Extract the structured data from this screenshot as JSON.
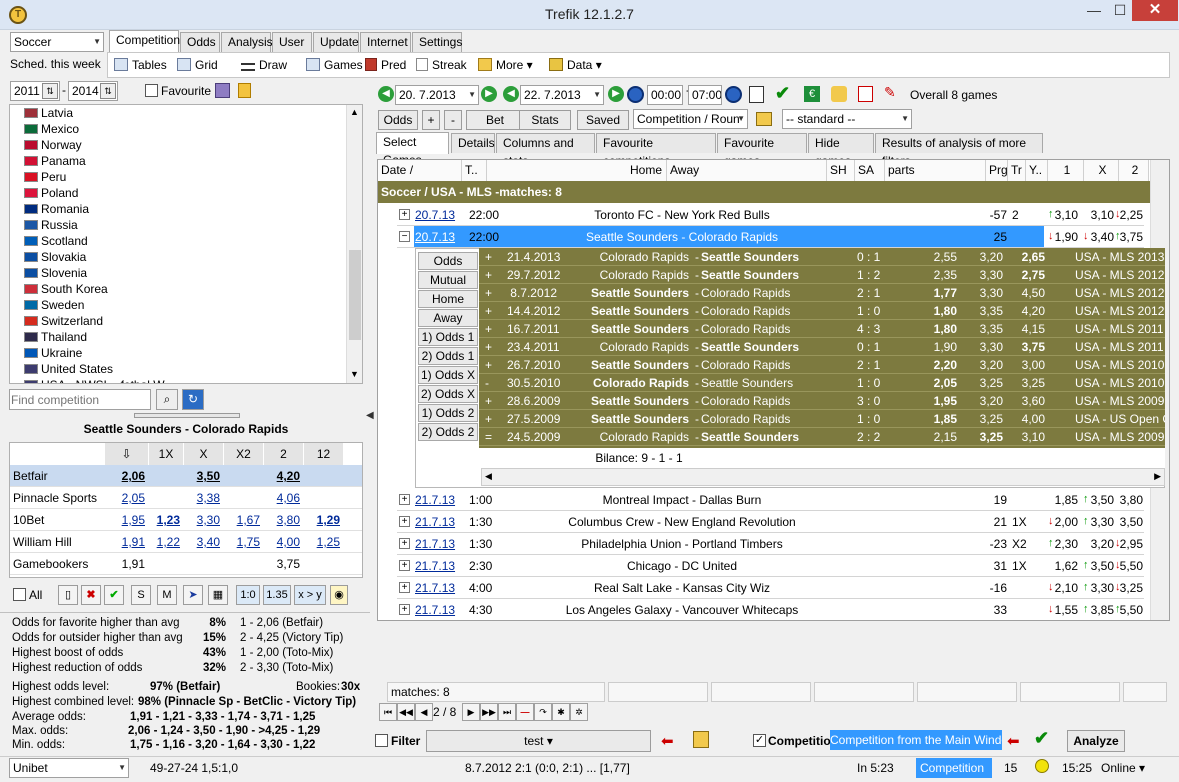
{
  "app": {
    "title": "Trefik 12.1.2.7"
  },
  "left": {
    "sport": "Soccer",
    "sched": "Sched. this week",
    "year_from": "2011",
    "year_to": "2014",
    "favourite_label": "Favourite",
    "countries": [
      "Latvia",
      "Mexico",
      "Norway",
      "Panama",
      "Peru",
      "Poland",
      "Romania",
      "Russia",
      "Scotland",
      "Slovakia",
      "Slovenia",
      "South Korea",
      "Sweden",
      "Switzerland",
      "Thailand",
      "Ukraine",
      "United States",
      "USA - NWSL - fotbal W"
    ],
    "find_placeholder": "Find competition",
    "match_title": "Seattle Sounders - Colorado Rapids",
    "odds_headers": [
      "1X",
      "X",
      "X2",
      "2",
      "12"
    ],
    "bookies": [
      {
        "name": "Betfair",
        "v": [
          "2,06",
          "",
          "3,50",
          "",
          "4,20",
          ""
        ]
      },
      {
        "name": "Pinnacle Sports",
        "v": [
          "2,05",
          "",
          "3,38",
          "",
          "4,06",
          ""
        ]
      },
      {
        "name": "10Bet",
        "v": [
          "1,95",
          "1,23",
          "3,30",
          "1,67",
          "3,80",
          "1,29"
        ]
      },
      {
        "name": "William Hill",
        "v": [
          "1,91",
          "1,22",
          "3,40",
          "1,75",
          "4,00",
          "1,25"
        ]
      },
      {
        "name": "Gamebookers",
        "v": [
          "1,91",
          "",
          "",
          "",
          "3,75",
          ""
        ]
      }
    ],
    "all_label": "All",
    "btn_s": "S",
    "btn_m": "M",
    "btn_10": "1:0",
    "btn_135": "1.35",
    "btn_xy": "x > y",
    "stats": [
      {
        "label": "Odds for favorite higher than avg",
        "value": "8%",
        "detail": "1 - 2,06 (Betfair)"
      },
      {
        "label": "Odds for outsider higher than avg",
        "value": "15%",
        "detail": "2 - 4,25 (Victory Tip)"
      },
      {
        "label": "Highest boost of odds",
        "value": "43%",
        "detail": "1 - 2,00 (Toto-Mix)"
      },
      {
        "label": "Highest reduction of odds",
        "value": "32%",
        "detail": "2 - 3,30 (Toto-Mix)"
      }
    ],
    "highest_level_label": "Highest odds level:",
    "highest_level_value": "97% (Betfair)",
    "bookies_label": "Bookies:",
    "bookies_value": "30x",
    "combined_label": "Highest combined level:",
    "combined_value": "98% (Pinnacle Sp - BetClic - Victory Tip)",
    "avg_label": "Average odds:",
    "avg_value": "1,91 - 1,21 - 3,33 - 1,74 - 3,71 - 1,25",
    "max_label": "Max. odds:",
    "max_value": "2,06 - 1,24 - 3,50 - 1,90 - >4,25 - 1,29",
    "min_label": "Min. odds:",
    "min_value": "1,75 - 1,16 - 3,20 - 1,64 - 3,30 - 1,22"
  },
  "tabs": [
    "Competition",
    "Odds",
    "Analysis",
    "User",
    "Update",
    "Internet",
    "Settings"
  ],
  "tools": [
    "Tables",
    "Grid",
    "Draw",
    "Games",
    "Pred",
    "Streak",
    "More",
    "Data"
  ],
  "filters": {
    "date_from": "20.  7.2013",
    "date_to": "22.  7.2013",
    "time_from": "00:00",
    "time_to": "07:00",
    "overall": "Overall 8 games",
    "b_odds": "Odds",
    "b_plus": "+",
    "b_minus": "-",
    "b_bet": "Bet",
    "b_stats": "Stats",
    "b_saved": "Saved",
    "round": "Competition / Roun",
    "standard": "-- standard --"
  },
  "subtabs": [
    "Select Games",
    "Details",
    "Columns and stats",
    "Favourite competitions",
    "Favourite games",
    "Hide games",
    "Results of analysis of more filters"
  ],
  "grid": {
    "headers": [
      "Date",
      "T..",
      "Home",
      "Away",
      "SH",
      "SA",
      "parts",
      "Prg",
      "Tr",
      "Y..",
      "1",
      "X",
      "2"
    ],
    "group": "Soccer / USA - MLS -matches: 8",
    "rows": [
      {
        "d": "20.7.13",
        "t": "22:00",
        "m": "Toronto FC - New York Red Bulls",
        "p": "-57",
        "tr": "2",
        "o1": "3,10",
        "ox": "3,10",
        "o2": "2,25"
      },
      {
        "d": "20.7.13",
        "t": "22:00",
        "m": "Seattle Sounders - Colorado Rapids",
        "p": "25",
        "tr": "",
        "o1": "1,90",
        "ox": "3,40",
        "o2": "3,75"
      },
      {
        "d": "21.7.13",
        "t": "1:00",
        "m": "Montreal Impact - Dallas Burn",
        "p": "19",
        "tr": "",
        "o1": "1,85",
        "ox": "3,50",
        "o2": "3,80"
      },
      {
        "d": "21.7.13",
        "t": "1:30",
        "m": "Columbus Crew - New England Revolution",
        "p": "21",
        "tr": "1X",
        "o1": "2,00",
        "ox": "3,30",
        "o2": "3,50"
      },
      {
        "d": "21.7.13",
        "t": "1:30",
        "m": "Philadelphia Union - Portland Timbers",
        "p": "-23",
        "tr": "X2",
        "o1": "2,30",
        "ox": "3,20",
        "o2": "2,95"
      },
      {
        "d": "21.7.13",
        "t": "2:30",
        "m": "Chicago - DC United",
        "p": "31",
        "tr": "1X",
        "o1": "1,62",
        "ox": "3,50",
        "o2": "5,50"
      },
      {
        "d": "21.7.13",
        "t": "4:00",
        "m": "Real Salt Lake - Kansas City Wiz",
        "p": "-16",
        "tr": "",
        "o1": "2,10",
        "ox": "3,30",
        "o2": "3,25"
      },
      {
        "d": "21.7.13",
        "t": "4:30",
        "m": "Los Angeles Galaxy - Vancouver Whitecaps",
        "p": "33",
        "tr": "",
        "o1": "1,55",
        "ox": "3,85",
        "o2": "5,50"
      }
    ]
  },
  "history": {
    "side": [
      "Odds",
      "Mutual",
      "Home",
      "Away",
      "1) Odds 1",
      "2) Odds 1",
      "1) Odds X",
      "2) Odds X",
      "1) Odds 2",
      "2) Odds 2"
    ],
    "rows": [
      {
        "s": "+",
        "d": "21.4.2013",
        "h": "Colorado Rapids",
        "a": "Seattle Sounders",
        "sc": "0 : 1",
        "o1": "2,55",
        "ox": "3,20",
        "o2": "2,65",
        "c": "USA - MLS 2013"
      },
      {
        "s": "+",
        "d": "29.7.2012",
        "h": "Colorado Rapids",
        "a": "Seattle Sounders",
        "sc": "1 : 2",
        "o1": "2,35",
        "ox": "3,30",
        "o2": "2,75",
        "c": "USA - MLS 2012"
      },
      {
        "s": "+",
        "d": "8.7.2012",
        "h": "Seattle Sounders",
        "a": "Colorado Rapids",
        "sc": "2 : 1",
        "o1": "1,77",
        "ox": "3,30",
        "o2": "4,50",
        "c": "USA - MLS 2012"
      },
      {
        "s": "+",
        "d": "14.4.2012",
        "h": "Seattle Sounders",
        "a": "Colorado Rapids",
        "sc": "1 : 0",
        "o1": "1,80",
        "ox": "3,35",
        "o2": "4,20",
        "c": "USA - MLS 2012"
      },
      {
        "s": "+",
        "d": "16.7.2011",
        "h": "Seattle Sounders",
        "a": "Colorado Rapids",
        "sc": "4 : 3",
        "o1": "1,80",
        "ox": "3,35",
        "o2": "4,15",
        "c": "USA - MLS 2011"
      },
      {
        "s": "+",
        "d": "23.4.2011",
        "h": "Colorado Rapids",
        "a": "Seattle Sounders",
        "sc": "0 : 1",
        "o1": "1,90",
        "ox": "3,30",
        "o2": "3,75",
        "c": "USA - MLS 2011"
      },
      {
        "s": "+",
        "d": "26.7.2010",
        "h": "Seattle Sounders",
        "a": "Colorado Rapids",
        "sc": "2 : 1",
        "o1": "2,20",
        "ox": "3,20",
        "o2": "3,00",
        "c": "USA - MLS 2010"
      },
      {
        "s": "-",
        "d": "30.5.2010",
        "h": "Colorado Rapids",
        "a": "Seattle Sounders",
        "sc": "1 : 0",
        "o1": "2,05",
        "ox": "3,25",
        "o2": "3,25",
        "c": "USA - MLS 2010"
      },
      {
        "s": "+",
        "d": "28.6.2009",
        "h": "Seattle Sounders",
        "a": "Colorado Rapids",
        "sc": "3 : 0",
        "o1": "1,95",
        "ox": "3,20",
        "o2": "3,60",
        "c": "USA - MLS 2009"
      },
      {
        "s": "+",
        "d": "27.5.2009",
        "h": "Seattle Sounders",
        "a": "Colorado Rapids",
        "sc": "1 : 0",
        "o1": "1,85",
        "ox": "3,25",
        "o2": "4,00",
        "c": "USA - US Open Cu"
      },
      {
        "s": "=",
        "d": "24.5.2009",
        "h": "Colorado Rapids",
        "a": "Seattle Sounders",
        "sc": "2 : 2",
        "o1": "2,15",
        "ox": "3,25",
        "o2": "3,10",
        "c": "USA - MLS 2009"
      }
    ],
    "balance": "Bilance: 9 - 1 - 1"
  },
  "footer": {
    "matches": "matches: 8",
    "page": "2 / 8",
    "filter": "Filter",
    "test": "test",
    "competition": "Competitio",
    "comp_main": "Competition from the Main Window",
    "analyze": "Analyze"
  },
  "status": {
    "bookie": "Unibet",
    "score": "49-27-24  1,5:1,0",
    "last": "8.7.2012 2:1 (0:0, 2:1) ... [1,77]",
    "in": "In 5:23",
    "comp": "Competition",
    "count": "15",
    "time": "15:25",
    "online": "Online"
  }
}
